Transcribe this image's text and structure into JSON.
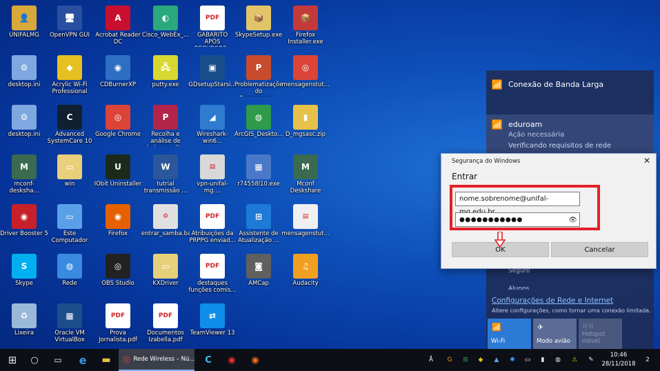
{
  "desktop": {
    "icons": [
      {
        "label": "UNIFALMG",
        "glyph": "👤",
        "bg": "#d8a93a"
      },
      {
        "label": "OpenVPN GUI",
        "glyph": "🖥",
        "bg": "#2a4ea0"
      },
      {
        "label": "Acrobat Reader DC",
        "glyph": "A",
        "bg": "#c8102e"
      },
      {
        "label": "Cisco_WebEx_...",
        "glyph": "◐",
        "bg": "#2aa87e"
      },
      {
        "label": "GABARITO APÓS RECURSOS - Jo...",
        "glyph": "PDF",
        "bg": "#ffffff"
      },
      {
        "label": "SkypeSetup.exe",
        "glyph": "📦",
        "bg": "#e0c56a"
      },
      {
        "label": "Firefox Installer.exe",
        "glyph": "📦",
        "bg": "#c43a3a"
      },
      {
        "label": "desktop.ini",
        "glyph": "⚙",
        "bg": "#7fa8e0"
      },
      {
        "label": "Acrylic Wi-Fi Professional",
        "glyph": "◆",
        "bg": "#e6c020"
      },
      {
        "label": "CDBurnerXP",
        "glyph": "◉",
        "bg": "#2e6fc4"
      },
      {
        "label": "putty.exe",
        "glyph": "🖧",
        "bg": "#d8d830"
      },
      {
        "label": "GDsetupStarsi...",
        "glyph": "▣",
        "bg": "#1a4d8c"
      },
      {
        "label": "Problematizações do Queermuse...",
        "glyph": "P",
        "bg": "#c74b2c"
      },
      {
        "label": "mensagenstut...",
        "glyph": "◎",
        "bg": "#db4437"
      },
      {
        "label": "desktop.ini",
        "glyph": "⚙",
        "bg": "#7fa8e0"
      },
      {
        "label": "Advanced SystemCare 10",
        "glyph": "C",
        "bg": "#102030"
      },
      {
        "label": "Google Chrome",
        "glyph": "◎",
        "bg": "#db4437"
      },
      {
        "label": "Recolha e análise de dados qualit...",
        "glyph": "P",
        "bg": "#b2244a"
      },
      {
        "label": "Wireshark-win6...",
        "glyph": "◢",
        "bg": "#2e7bd0"
      },
      {
        "label": "ArcGIS_Deskto...",
        "glyph": "◍",
        "bg": "#2e9a4a"
      },
      {
        "label": "D_mgsasc.zip",
        "glyph": "▮",
        "bg": "#e7c24a"
      },
      {
        "label": "mconf-desksha...",
        "glyph": "M",
        "bg": "#3a6a50"
      },
      {
        "label": "win",
        "glyph": "▭",
        "bg": "#e8cf7a"
      },
      {
        "label": "IObit Uninstaller",
        "glyph": "U",
        "bg": "#1b2a1b"
      },
      {
        "label": "tutrial transmissão ...",
        "glyph": "W",
        "bg": "#2b579a"
      },
      {
        "label": "vpn-unifal-mg....",
        "glyph": "▤",
        "bg": "#d8d8d8"
      },
      {
        "label": "r74558l10.exe",
        "glyph": "▦",
        "bg": "#4a78c8"
      },
      {
        "label": "Mconf Deskshare",
        "glyph": "M",
        "bg": "#3a6a50"
      },
      {
        "label": "Driver Booster 5",
        "glyph": "◉",
        "bg": "#c8202a"
      },
      {
        "label": "Este Computador",
        "glyph": "▭",
        "bg": "#5aa0e8"
      },
      {
        "label": "Firefox",
        "glyph": "◉",
        "bg": "#e66000"
      },
      {
        "label": "entrar_samba.bat",
        "glyph": "⚙",
        "bg": "#e0e0e0"
      },
      {
        "label": "Atribuições da PRPPG enviad...",
        "glyph": "PDF",
        "bg": "#ffffff"
      },
      {
        "label": "Assistente de Atualização ...",
        "glyph": "⊞",
        "bg": "#1e7ad6"
      },
      {
        "label": "mensagenstut...",
        "glyph": "▤",
        "bg": "#f0f0f0"
      },
      {
        "label": "Skype",
        "glyph": "S",
        "bg": "#00aff0"
      },
      {
        "label": "Rede",
        "glyph": "◍",
        "bg": "#3a8ae0"
      },
      {
        "label": "OBS Studio",
        "glyph": "◎",
        "bg": "#222222"
      },
      {
        "label": "KXDriver",
        "glyph": "▭",
        "bg": "#e8cf7a"
      },
      {
        "label": "destaques funções comis...",
        "glyph": "PDF",
        "bg": "#ffffff"
      },
      {
        "label": "AMCap",
        "glyph": "◙",
        "bg": "#606060"
      },
      {
        "label": "Audacity",
        "glyph": "♫",
        "bg": "#f0a020"
      },
      {
        "label": "Lixeira",
        "glyph": "♻",
        "bg": "#9ab8d8"
      },
      {
        "label": "Oracle VM VirtualBox",
        "glyph": "▦",
        "bg": "#1d4e8c"
      },
      {
        "label": "Prova Jornalista.pdf",
        "glyph": "PDF",
        "bg": "#ffffff"
      },
      {
        "label": "Documentos Izabella.pdf",
        "glyph": "PDF",
        "bg": "#ffffff"
      },
      {
        "label": "TeamViewer 13",
        "glyph": "⇄",
        "bg": "#0e8ee9"
      }
    ]
  },
  "flyout": {
    "broadband": {
      "glyph": "📶",
      "label": "Conexão de Banda Larga"
    },
    "eduroam": {
      "glyph": "📶",
      "name": "eduroam",
      "status": "Ação necessária",
      "partial": "Verificando requisitos de rede"
    },
    "hidden1": "Seguro",
    "hidden2": "Alunos",
    "settings_link": "Configurações de Rede e Internet",
    "settings_note": "Altere configurações, como tornar uma conexão limitada.",
    "tiles": [
      {
        "glyph": "📶",
        "label": "Wi-Fi"
      },
      {
        "glyph": "✈",
        "label": "Modo avião"
      },
      {
        "glyph": "((·))",
        "label": "Hotspot móvel"
      }
    ]
  },
  "dialog": {
    "title": "Segurança do Windows",
    "close": "✕",
    "heading": "Entrar",
    "username": "nome.sobrenome@unifal-mg.edu.br",
    "password_mask": "●●●●●●●●●●●",
    "eye": "👁",
    "ok": "OK",
    "cancel": "Cancelar"
  },
  "taskbar": {
    "start": "⊞",
    "search": "○",
    "taskview": "▭",
    "edge": "e",
    "explorer": "▬",
    "chrome_app": {
      "glyph": "◎",
      "label": "Rede Wireless – Nú..."
    },
    "ccleaner": "C",
    "driver_booster": "◉",
    "firefox": "◉",
    "tray": [
      "Å",
      "G",
      "⊞",
      "◆",
      "▲",
      "✱",
      "▭",
      "▮",
      "◍",
      "⚠",
      "✎"
    ],
    "time": "10:46",
    "date": "28/11/2018",
    "notifications": "2"
  }
}
